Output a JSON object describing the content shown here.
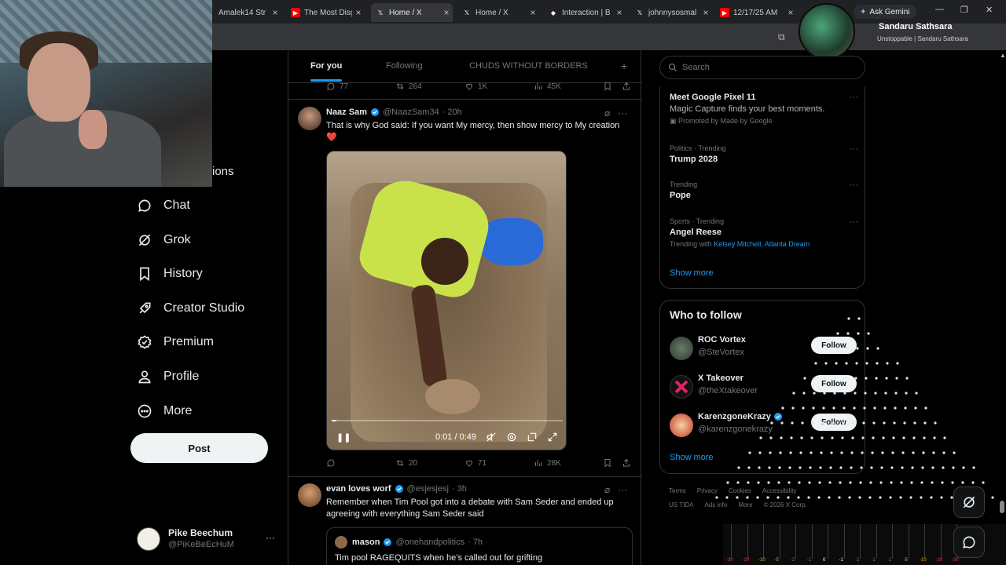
{
  "browser": {
    "tabs": [
      {
        "title": "Amalek14 Str",
        "icon": "tab-icon",
        "color": "#1f2125"
      },
      {
        "title": "The Most Disg",
        "icon": "youtube-icon",
        "color": "#ff0000"
      },
      {
        "title": "Home / X",
        "icon": "x-icon",
        "color": "#000000"
      },
      {
        "title": "Home / X",
        "icon": "x-icon",
        "color": "#000000"
      },
      {
        "title": "Interaction | B",
        "icon": "diamond-icon",
        "color": "#ffffff"
      },
      {
        "title": "johnnysosmal",
        "icon": "x-icon",
        "color": "#000000"
      },
      {
        "title": "12/17/25 AM",
        "icon": "youtube-icon",
        "color": "#ff0000"
      }
    ],
    "gemini_label": "Ask Gemini",
    "profile_name": "Sandaru Sathsara",
    "profile_sub": "Unstoppable | Sandaru Sathsara"
  },
  "nav": {
    "partial_label": "ions",
    "items": [
      {
        "label": "Chat",
        "icon": "chat-icon"
      },
      {
        "label": "Grok",
        "icon": "grok-icon"
      },
      {
        "label": "History",
        "icon": "bookmark-icon"
      },
      {
        "label": "Creator Studio",
        "icon": "rocket-icon"
      },
      {
        "label": "Premium",
        "icon": "premium-icon"
      },
      {
        "label": "Profile",
        "icon": "person-icon"
      },
      {
        "label": "More",
        "icon": "more-circle-icon"
      }
    ],
    "post_label": "Post",
    "account": {
      "name": "Pike Beechum",
      "handle": "@PiKeBeEcHuM",
      "more": "···"
    }
  },
  "feed": {
    "tabs": [
      "For you",
      "Following",
      "CHUDS WITHOUT BORDERS"
    ],
    "plus": "+",
    "top_actions": {
      "replies": "77",
      "reposts": "264",
      "likes": "1K",
      "views": "45K"
    },
    "tweet1": {
      "name": "Naaz Sam",
      "handle": "@NaazSam34",
      "time": "· 20h",
      "text": "That is why God said: If you want My mercy, then show mercy to My creation",
      "emoji": "❤️",
      "video_time": "0:01 / 0:49",
      "video_progress": 0.02,
      "actions": {
        "replies": "",
        "reposts": "20",
        "likes": "71",
        "views": "28K"
      }
    },
    "tweet2": {
      "name": "evan loves worf",
      "handle": "@esjesjesj",
      "time": "· 3h",
      "text": "Remember when Tim Pool got into a debate with Sam Seder and ended up agreeing with everything Sam Seder said",
      "quote": {
        "name": "mason",
        "handle": "@onehandpolitics",
        "time": "· 7h",
        "text": "Tim pool RAGEQUITS when he’s called out for grifting"
      }
    }
  },
  "sidebar": {
    "search_placeholder": "Search",
    "ad": {
      "title": "Meet Google Pixel 11",
      "desc": "Magic Capture finds your best moments.",
      "promoted": "Promoted by Made by Google"
    },
    "trends": [
      {
        "meta": "Politics · Trending",
        "title": "Trump 2028"
      },
      {
        "meta": "Trending",
        "title": "Pope"
      },
      {
        "meta": "Sports · Trending",
        "title": "Angel Reese",
        "with_label": "Trending with",
        "with_links": "Kelsey Mitchell, Atlanta Dream"
      }
    ],
    "show_more": "Show more",
    "who_to_follow": "Who to follow",
    "follows": [
      {
        "name": "ROC Vortex",
        "handle": "@SteVortex",
        "button": "Follow"
      },
      {
        "name": "X Takeover",
        "handle": "@theXtakeover",
        "button": "Follow"
      },
      {
        "name": "KarenzgoneKrazy",
        "handle": "@karenzgonekrazy",
        "button": "Follow"
      }
    ],
    "footer1": [
      "Terms",
      "Privacy",
      "Cookies",
      "Accessibility"
    ],
    "footer2": [
      "US TIDA",
      "Ads info",
      "More",
      "© 2026 X Corp."
    ]
  },
  "mixer_labels": [
    "-30",
    "-20",
    "-10",
    "-5",
    "-2",
    "-1",
    "0",
    "-1",
    "-2",
    "-1",
    "-2",
    "-5",
    "-10",
    "-20",
    "-30"
  ],
  "colors": {
    "accent": "#1d9bf0",
    "bg": "#000000",
    "border": "#2f3336",
    "heart": "#f91880"
  }
}
